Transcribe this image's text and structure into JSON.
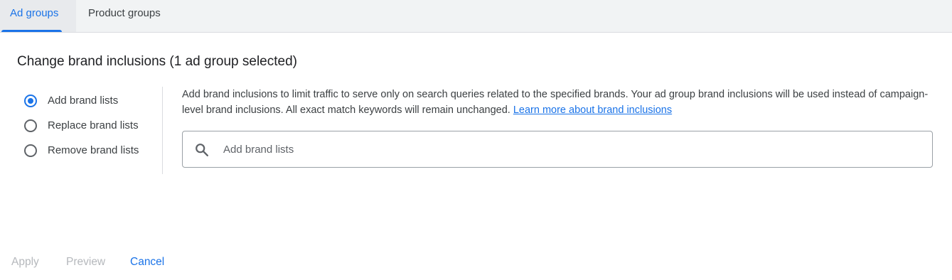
{
  "tabs": [
    {
      "label": "Ad groups",
      "active": true
    },
    {
      "label": "Product groups",
      "active": false
    }
  ],
  "page_title": "Change brand inclusions (1 ad group selected)",
  "radio_options": [
    {
      "label": "Add brand lists",
      "checked": true
    },
    {
      "label": "Replace brand lists",
      "checked": false
    },
    {
      "label": "Remove brand lists",
      "checked": false
    }
  ],
  "description": {
    "text": "Add brand inclusions to limit traffic to serve only on search queries related to the specified brands. Your ad group brand inclusions will be used instead of campaign-level brand inclusions. All exact match keywords will remain unchanged.",
    "link_text": "Learn more about brand inclusions"
  },
  "search": {
    "placeholder": "Add brand lists",
    "value": "",
    "icon": "search-icon"
  },
  "footer": {
    "apply_label": "Apply",
    "preview_label": "Preview",
    "cancel_label": "Cancel"
  },
  "colors": {
    "accent": "#1a73e8",
    "tabbar_bg": "#f1f3f4",
    "disabled_text": "#b5b8bc"
  }
}
